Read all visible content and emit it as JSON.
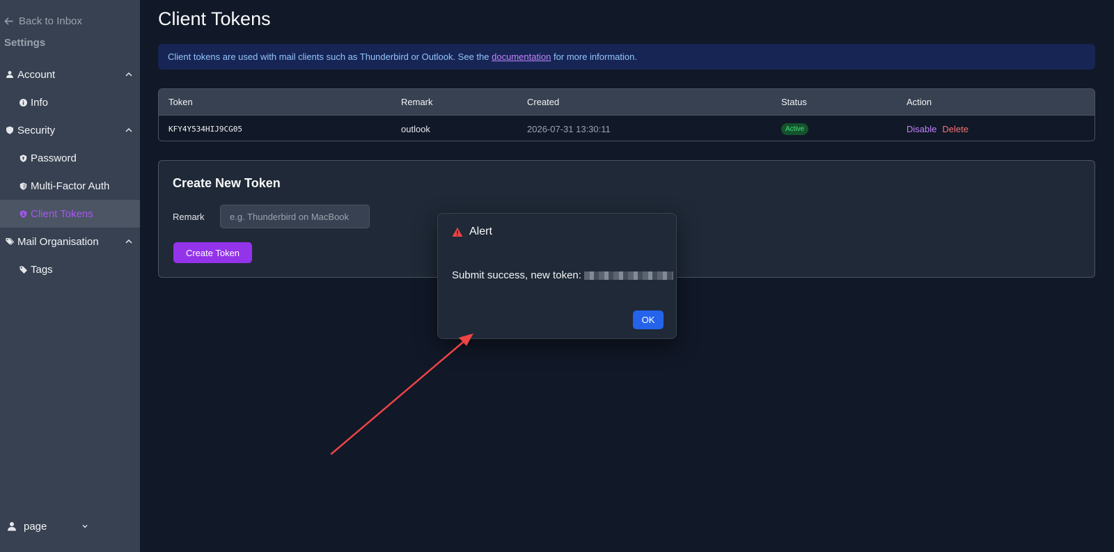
{
  "sidebar": {
    "back_label": "Back to Inbox",
    "settings_title": "Settings",
    "groups": [
      {
        "label": "Account",
        "items": [
          {
            "label": "Info"
          }
        ]
      },
      {
        "label": "Security",
        "items": [
          {
            "label": "Password"
          },
          {
            "label": "Multi-Factor Auth"
          },
          {
            "label": "Client Tokens",
            "active": true
          }
        ]
      },
      {
        "label": "Mail Organisation",
        "items": [
          {
            "label": "Tags"
          }
        ]
      }
    ],
    "user": "page"
  },
  "main": {
    "title": "Client Tokens",
    "banner": {
      "prefix": "Client tokens are used with mail clients such as Thunderbird or Outlook. See the",
      "link": "documentation",
      "suffix": "for more information."
    },
    "table": {
      "headers": {
        "token": "Token",
        "remark": "Remark",
        "created": "Created",
        "status": "Status",
        "action": "Action"
      },
      "rows": [
        {
          "token": "KFY4Y534HIJ9CG05",
          "remark": "outlook",
          "created": "2026-07-31 13:30:11",
          "status": "Active",
          "disable": "Disable",
          "delete": "Delete"
        }
      ]
    },
    "create": {
      "title": "Create New Token",
      "remark_label": "Remark",
      "remark_placeholder": "e.g. Thunderbird on MacBook",
      "remark_value": "",
      "button": "Create Token"
    }
  },
  "modal": {
    "title": "Alert",
    "message": "Submit success, new token:",
    "ok": "OK"
  },
  "colors": {
    "accent": "#9333ea",
    "active_nav": "#a855f7",
    "ok_button": "#2563eb",
    "annotation_arrow": "#ef4444"
  }
}
